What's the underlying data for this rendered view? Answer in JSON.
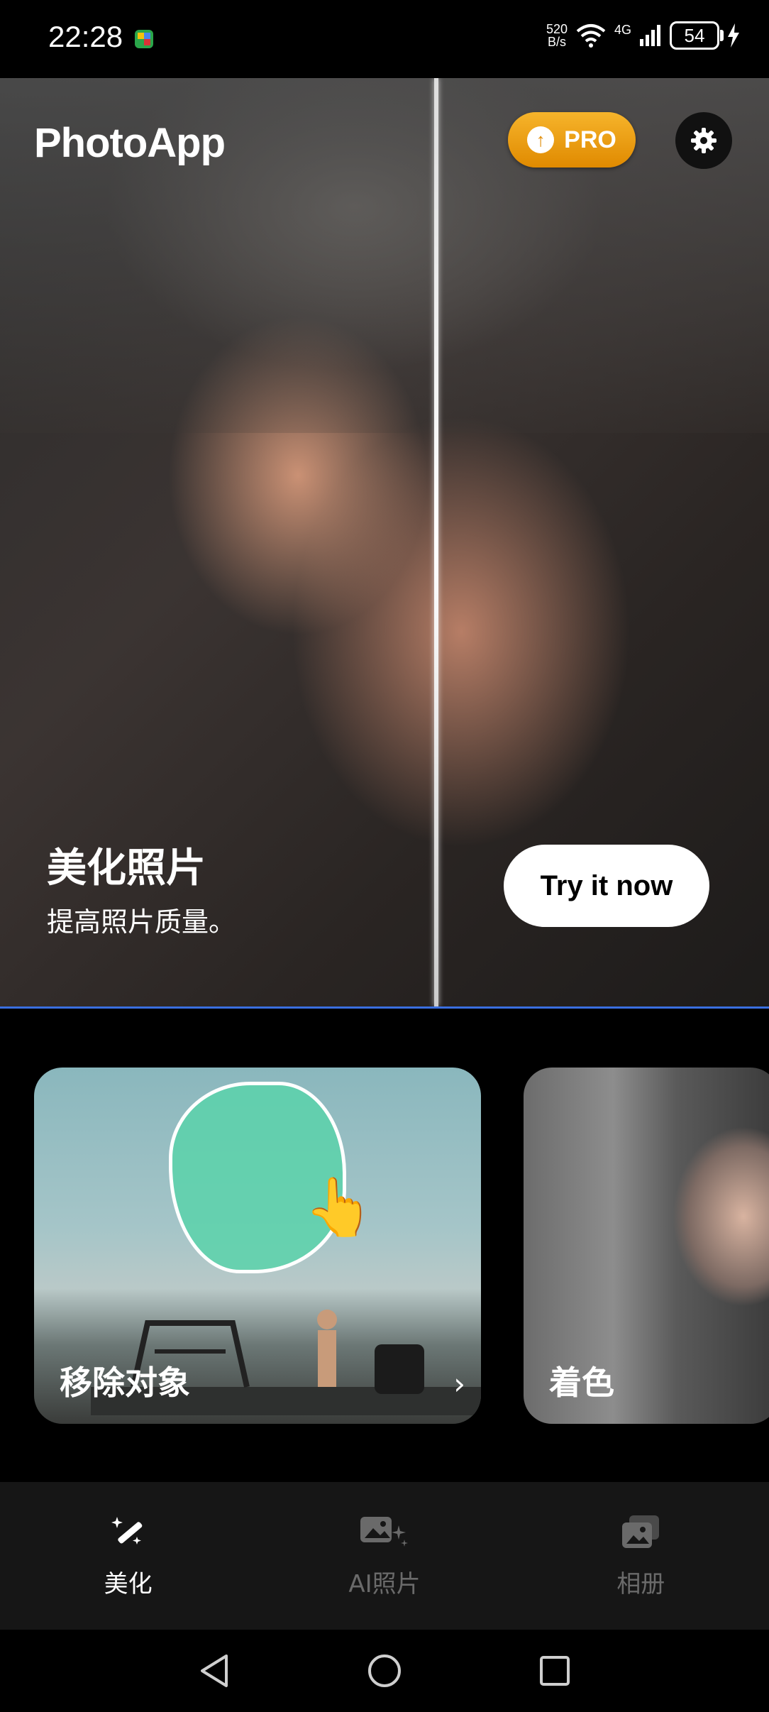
{
  "status_bar": {
    "time": "22:28",
    "net_speed_value": "520",
    "net_speed_unit": "B/s",
    "network": "4G",
    "battery": "54"
  },
  "header": {
    "logo": "PhotoApp",
    "pro_label": "PRO"
  },
  "hero": {
    "title": "美化照片",
    "subtitle": "提高照片质量。",
    "cta": "Try it now"
  },
  "cards": [
    {
      "label": "移除对象"
    },
    {
      "label": "着色"
    }
  ],
  "bottom_nav": {
    "items": [
      {
        "label": "美化",
        "icon": "magic-wand-icon",
        "active": true
      },
      {
        "label": "AI照片",
        "icon": "ai-image-icon",
        "active": false
      },
      {
        "label": "相册",
        "icon": "album-icon",
        "active": false
      }
    ]
  },
  "colors": {
    "pro_gradient_top": "#f6b42b",
    "pro_gradient_bottom": "#e08a00",
    "hero_underline": "#3a6fe0",
    "nav_inactive": "#6a6a6a"
  }
}
